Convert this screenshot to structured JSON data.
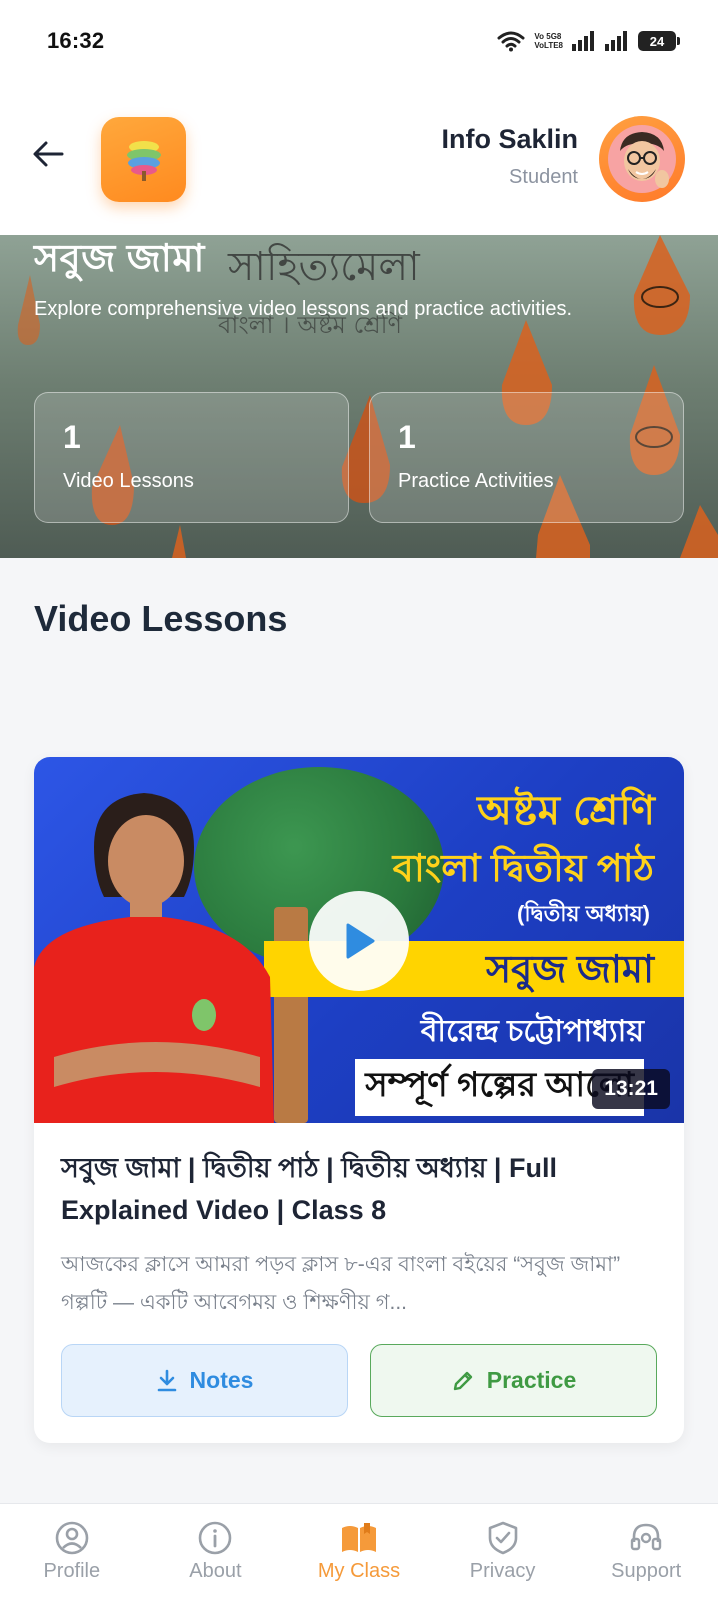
{
  "status_bar": {
    "time": "16:32",
    "network_top": "Vo 5G8",
    "network_bottom": "VoLTE8",
    "battery": "24"
  },
  "header": {
    "user_name": "Info Saklin",
    "user_role": "Student"
  },
  "hero": {
    "title": "সবুজ জামা",
    "bg_title": "সাহিত্যমেলা",
    "bg_subtitle": "বাংলা । অষ্টম শ্রেণি",
    "description": "Explore comprehensive video lessons and practice activities.",
    "stats": [
      {
        "value": "1",
        "label": "Video Lessons"
      },
      {
        "value": "1",
        "label": "Practice Activities"
      }
    ]
  },
  "section": {
    "title": "Video Lessons"
  },
  "video": {
    "thumbnail_text": {
      "line1": "অষ্টম শ্রেণি",
      "line2": "বাংলা দ্বিতীয় পাঠ",
      "line3": "(দ্বিতীয় অধ্যায়)",
      "line4": "সবুজ জামা",
      "line5": "বীরেন্দ্র চট্টোপাধ্যায়",
      "line6": "সম্পূর্ণ গল্পের আলো"
    },
    "duration": "13:21",
    "title": "সবুজ জামা | দ্বিতীয় পাঠ | দ্বিতীয় অধ্যায় | Full Explained Video | Class 8",
    "description": "আজকের ক্লাসে আমরা পড়ব ক্লাস ৮-এর বাংলা বইয়ের “সবুজ জামা” গল্পটি — একটি আবেগময় ও শিক্ষণীয় গ...",
    "notes_label": "Notes",
    "practice_label": "Practice"
  },
  "bottom_nav": {
    "items": [
      {
        "label": "Profile",
        "icon": "profile-icon"
      },
      {
        "label": "About",
        "icon": "info-icon"
      },
      {
        "label": "My Class",
        "icon": "book-icon"
      },
      {
        "label": "Privacy",
        "icon": "shield-check-icon"
      },
      {
        "label": "Support",
        "icon": "headset-icon"
      }
    ],
    "active": "My Class"
  },
  "colors": {
    "accent": "#f59a3a",
    "notes_blue": "#2f8ce0",
    "practice_green": "#3f9a43"
  }
}
